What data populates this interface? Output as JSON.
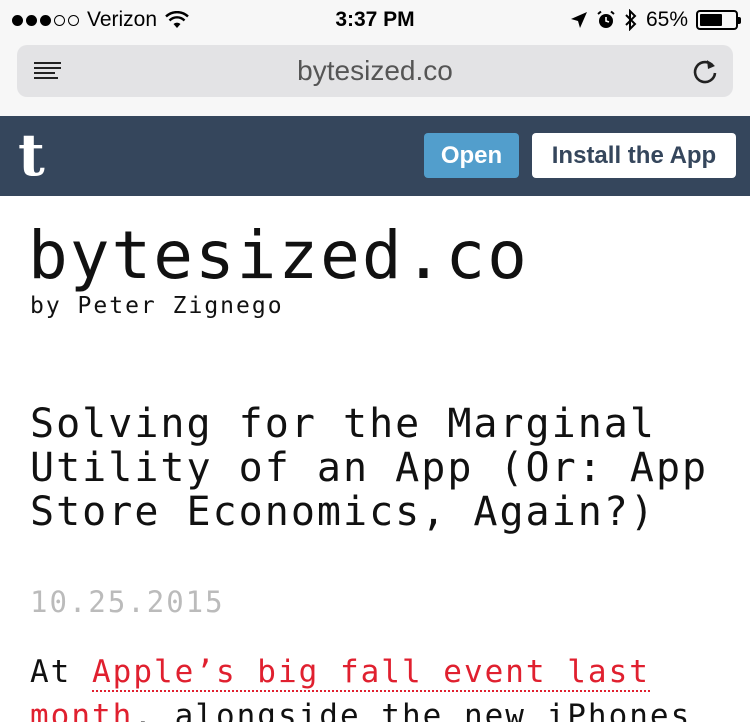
{
  "status_bar": {
    "signal_full": 3,
    "signal_total": 5,
    "carrier": "Verizon",
    "time": "3:37 PM",
    "battery": "65%",
    "battery_level": 0.65
  },
  "browser": {
    "url": "bytesized.co"
  },
  "tumblr_banner": {
    "logo": "t",
    "open_label": "Open",
    "install_label": "Install the App",
    "colors": {
      "banner": "#35465c",
      "open_button": "#529ecc"
    }
  },
  "blog": {
    "title": "bytesized.co",
    "byline": "by Peter Zignego"
  },
  "post": {
    "title": "Solving for the Marginal Utility of an App (Or: App Store Economics, Again?)",
    "date": "10.25.2015",
    "body_intro": "At ",
    "link_text": "Apple’s big fall event last month",
    "body_rest": ", alongside the new iPhones",
    "link_color": "#e0202f"
  }
}
